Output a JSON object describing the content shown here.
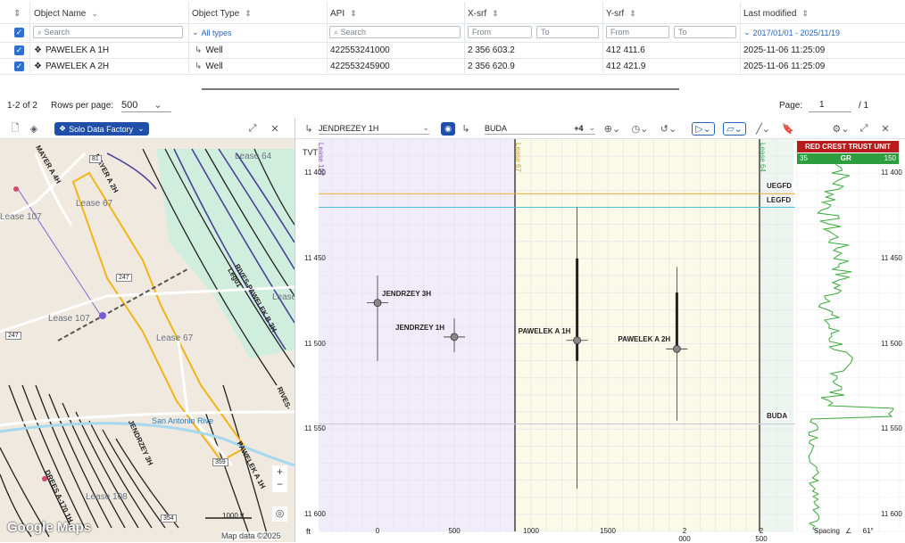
{
  "table": {
    "headers": [
      "Object Name",
      "Object Type",
      "API",
      "X-srf",
      "Y-srf",
      "Last modified"
    ],
    "filters": {
      "name_placeholder": "Search",
      "type_value": "All types",
      "api_placeholder": "Search",
      "x_from": "From",
      "x_to": "To",
      "y_from": "From",
      "y_to": "To",
      "date_range": "2017/01/01 - 2025/11/19"
    },
    "rows": [
      {
        "name": "PAWELEK A 1H",
        "type": "Well",
        "api": "422553241000",
        "x": "2 356 603.2",
        "y": "412 411.6",
        "modified": "2025-11-06 11:25:09"
      },
      {
        "name": "PAWELEK A 2H",
        "type": "Well",
        "api": "422553245900",
        "x": "2 356 620.9",
        "y": "412 421.9",
        "modified": "2025-11-06 11:25:09"
      }
    ],
    "footer": {
      "range": "1-2 of 2",
      "rows_label": "Rows per page:",
      "rows_value": "500",
      "page_label": "Page:",
      "page_value": "1",
      "page_total": "/ 1"
    }
  },
  "map": {
    "badge": "Solo Data Factory",
    "labels": {
      "lease64": "Lease 64",
      "lease67a": "Lease 67",
      "lease107a": "Lease 107",
      "lease107b": "Lease 107",
      "lease67b": "Lease 67",
      "lease108": "Lease 108",
      "lease_x": "Lease",
      "mayer4": "MAYER A 4H",
      "mayer2": "MAYER A 2H",
      "rives": "RIVES-PAWELEK B 3H-Leg01",
      "rives2": "RIVES-",
      "jendrzey": "JENDRZEY 3H",
      "paw1": "PAWELEK A 1H",
      "dree": "DREES A-170 1H",
      "river": "San Antonio Rive",
      "r81": "81",
      "r247a": "247",
      "r247b": "247",
      "r359": "359",
      "r354": "354"
    },
    "scale": "1000 ft",
    "google": "Google Maps",
    "attrib": "Map data ©2025"
  },
  "section": {
    "well_select": "JENDREZEY 1H",
    "target_select": "BUDA",
    "extra_count": "+4",
    "tvt_label": "TVT",
    "depth_ticks": [
      "11 400",
      "11 450",
      "11 500",
      "11 550",
      "11 600"
    ],
    "x_ticks": [
      "0",
      "500",
      "1000",
      "1500",
      "2 000",
      "2 500"
    ],
    "x_unit": "ft",
    "leases": [
      "Lease 107",
      "Lease 67",
      "Lease 64"
    ],
    "horizons": [
      {
        "name": "UEGFD",
        "depth": 11412,
        "color": "#e6a93a"
      },
      {
        "name": "LEGFD",
        "depth": 11420,
        "color": "#4fc0d6"
      },
      {
        "name": "BUDA",
        "depth": 11547,
        "color": "#c9c6d6"
      }
    ],
    "wells": [
      {
        "name": "JENDRZEY 3H",
        "x": 0,
        "depth": 11476
      },
      {
        "name": "JENDRZEY 1H",
        "x": 500,
        "depth": 11496
      },
      {
        "name": "PAWELEK A 1H",
        "x": 1300,
        "depth": 11498
      },
      {
        "name": "PAWELEK A 2H",
        "x": 1950,
        "depth": 11503
      }
    ],
    "log": {
      "title": "RED CREST TRUST UNIT",
      "curve": "GR",
      "min": "35",
      "max": "150",
      "spacing_label": "Spacing",
      "angle": "61°"
    }
  }
}
